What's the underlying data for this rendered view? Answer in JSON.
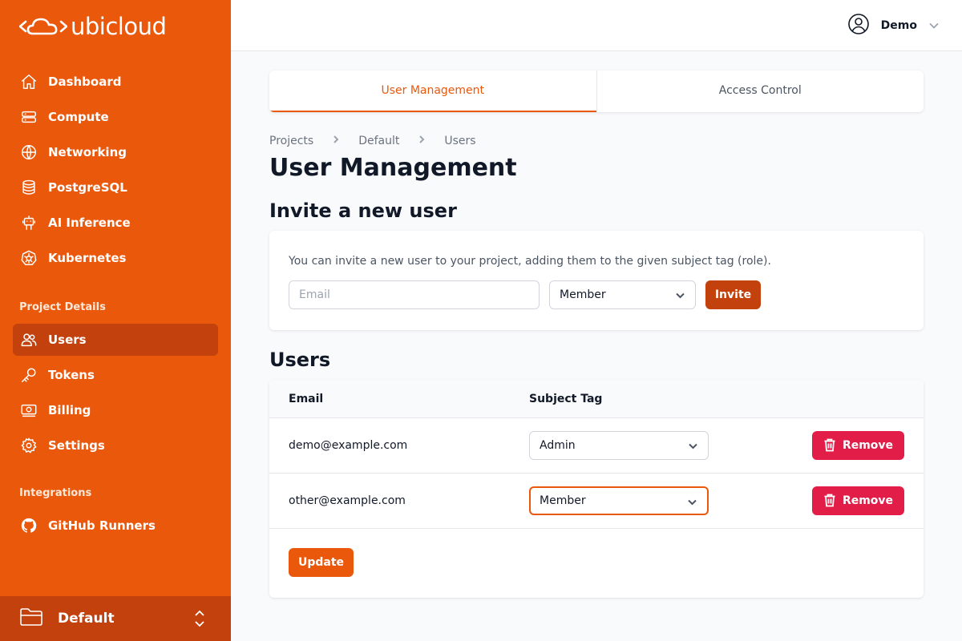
{
  "brand": {
    "name": "ubicloud"
  },
  "sidebar": {
    "items": [
      {
        "label": "Dashboard",
        "icon": "home-icon"
      },
      {
        "label": "Compute",
        "icon": "server-icon"
      },
      {
        "label": "Networking",
        "icon": "globe-icon"
      },
      {
        "label": "PostgreSQL",
        "icon": "database-icon"
      },
      {
        "label": "AI Inference",
        "icon": "robot-icon"
      },
      {
        "label": "Kubernetes",
        "icon": "kubernetes-icon"
      }
    ],
    "project_section_title": "Project Details",
    "project_items": [
      {
        "label": "Users",
        "icon": "users-icon",
        "active": true
      },
      {
        "label": "Tokens",
        "icon": "key-icon"
      },
      {
        "label": "Billing",
        "icon": "banknote-icon"
      },
      {
        "label": "Settings",
        "icon": "gear-icon"
      }
    ],
    "integrations_title": "Integrations",
    "integration_items": [
      {
        "label": "GitHub Runners",
        "icon": "github-icon"
      }
    ],
    "project_switcher": {
      "label": "Default"
    }
  },
  "header": {
    "user_name": "Demo"
  },
  "tabs": [
    {
      "label": "User Management",
      "active": true
    },
    {
      "label": "Access Control",
      "active": false
    }
  ],
  "breadcrumb": [
    "Projects",
    "Default",
    "Users"
  ],
  "page_title": "User Management",
  "invite": {
    "title": "Invite a new user",
    "description": "You can invite a new user to your project, adding them to the given subject tag (role).",
    "email_placeholder": "Email",
    "role_value": "Member",
    "button": "Invite"
  },
  "users": {
    "title": "Users",
    "columns": {
      "email": "Email",
      "tag": "Subject Tag"
    },
    "rows": [
      {
        "email": "demo@example.com",
        "tag": "Admin",
        "remove": "Remove"
      },
      {
        "email": "other@example.com",
        "tag": "Member",
        "remove": "Remove"
      }
    ],
    "update_button": "Update"
  },
  "colors": {
    "brand": "#ea580c",
    "brand_dark": "#c2410c",
    "danger": "#e11d48"
  }
}
